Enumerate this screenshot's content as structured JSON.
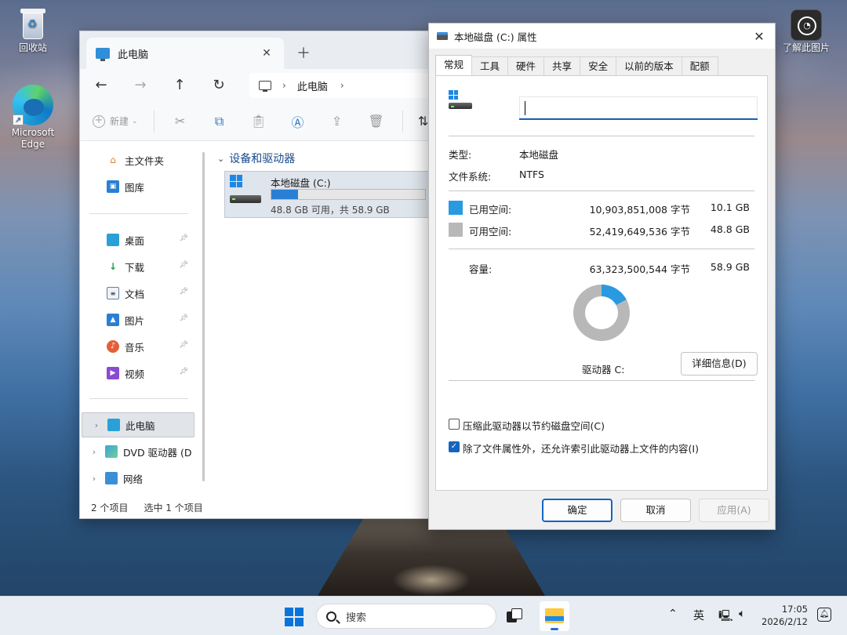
{
  "desktop": {
    "recycle_bin": "回收站",
    "edge": "Microsoft Edge",
    "learn": "了解此图片"
  },
  "explorer": {
    "tab_title": "此电脑",
    "breadcrumb": [
      "此电脑"
    ],
    "toolbar": {
      "new_label": "新建"
    },
    "sidebar": {
      "home": "主文件夹",
      "gallery": "图库",
      "desktop": "桌面",
      "downloads": "下载",
      "documents": "文档",
      "pictures": "图片",
      "music": "音乐",
      "videos": "视频",
      "this_pc": "此电脑",
      "dvd": "DVD 驱动器 (D",
      "network": "网络"
    },
    "group_header": "设备和驱动器",
    "drive": {
      "name": "本地磁盘 (C:)",
      "free_text": "48.8 GB 可用，共 58.9 GB",
      "used_fraction": 0.172
    },
    "status": {
      "count": "2 个项目",
      "selected": "选中 1 个项目"
    }
  },
  "properties": {
    "title": "本地磁盘 (C:) 属性",
    "tabs": [
      "常规",
      "工具",
      "硬件",
      "共享",
      "安全",
      "以前的版本",
      "配额"
    ],
    "name_value": "",
    "type_label": "类型:",
    "type_value": "本地磁盘",
    "fs_label": "文件系统:",
    "fs_value": "NTFS",
    "used_label": "已用空间:",
    "used_bytes": "10,903,851,008 字节",
    "used_gb": "10.1 GB",
    "free_label": "可用空间:",
    "free_bytes": "52,419,649,536 字节",
    "free_gb": "48.8 GB",
    "cap_label": "容量:",
    "cap_bytes": "63,323,500,544 字节",
    "cap_gb": "58.9 GB",
    "used_fraction": 0.172,
    "drive_label": "驱动器 C:",
    "details_button": "详细信息(D)",
    "compress_label": "压缩此驱动器以节约磁盘空间(C)",
    "index_label": "除了文件属性外，还允许索引此驱动器上文件的内容(I)",
    "ok_button": "确定",
    "cancel_button": "取消",
    "apply_button": "应用(A)",
    "colors": {
      "used": "#2a9ae0",
      "free": "#b8b8b8"
    }
  },
  "taskbar": {
    "search_label": "搜索",
    "ime": "英",
    "time": "17:05",
    "date": "2026/2/12"
  }
}
